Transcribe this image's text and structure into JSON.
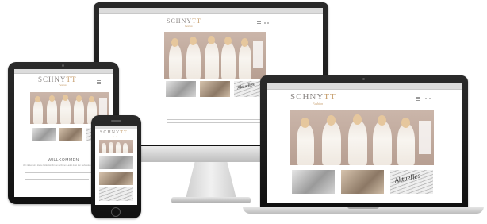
{
  "brand": {
    "logo_text": "SCHNYTT",
    "logo_sub": "Fashion"
  },
  "content": {
    "heading": "WILLKOMMEN",
    "intro": "Wir zählen eine kleine Kollektion für den schönen Laden & an den Gebäuden Ihrer Erholung"
  },
  "thumbnails": [
    {
      "label": ""
    },
    {
      "label": ""
    },
    {
      "label": "Aktuelles"
    }
  ],
  "devices": [
    "desktop-monitor",
    "tablet",
    "smartphone",
    "laptop"
  ],
  "colors": {
    "brand_gold": "#c59c6a",
    "logo_grey": "#8a8583",
    "hero_bg": "#bfa99c",
    "device_black": "#1a1a1a",
    "device_silver": "#d2d2d2"
  }
}
